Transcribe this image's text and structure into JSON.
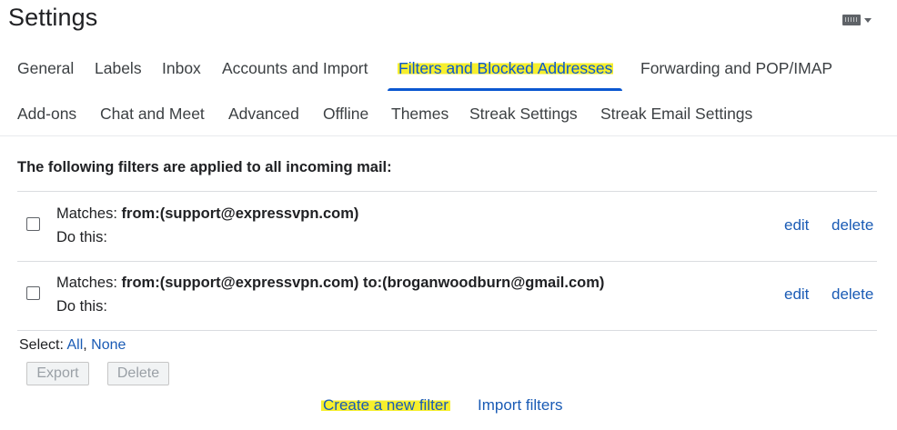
{
  "page": {
    "title": "Settings"
  },
  "tabs_row1": [
    {
      "label": "General"
    },
    {
      "label": "Labels"
    },
    {
      "label": "Inbox"
    },
    {
      "label": "Accounts and Import"
    },
    {
      "label": "Filters and Blocked Addresses",
      "active": true
    },
    {
      "label": "Forwarding and POP/IMAP"
    }
  ],
  "tabs_row2": [
    {
      "label": "Add-ons"
    },
    {
      "label": "Chat and Meet"
    },
    {
      "label": "Advanced"
    },
    {
      "label": "Offline"
    },
    {
      "label": "Themes"
    },
    {
      "label": "Streak Settings"
    },
    {
      "label": "Streak Email Settings"
    }
  ],
  "filters": {
    "heading": "The following filters are applied to all incoming mail:",
    "items": [
      {
        "matches_label": "Matches:",
        "criteria": "from:(support@expressvpn.com)",
        "action_label": "Do this:",
        "edit": "edit",
        "delete": "delete"
      },
      {
        "matches_label": "Matches:",
        "criteria": "from:(support@expressvpn.com) to:(broganwoodburn@gmail.com)",
        "action_label": "Do this:",
        "edit": "edit",
        "delete": "delete"
      }
    ]
  },
  "select": {
    "label": "Select:",
    "all": "All",
    "separator": ",",
    "none": "None"
  },
  "buttons": {
    "export": "Export",
    "delete": "Delete"
  },
  "links": {
    "create_filter": "Create a new filter",
    "import_filters": "Import filters"
  },
  "colors": {
    "link": "#1a5bb5",
    "active_tab": "#0b57d0",
    "highlight": "#f6ef2d"
  }
}
